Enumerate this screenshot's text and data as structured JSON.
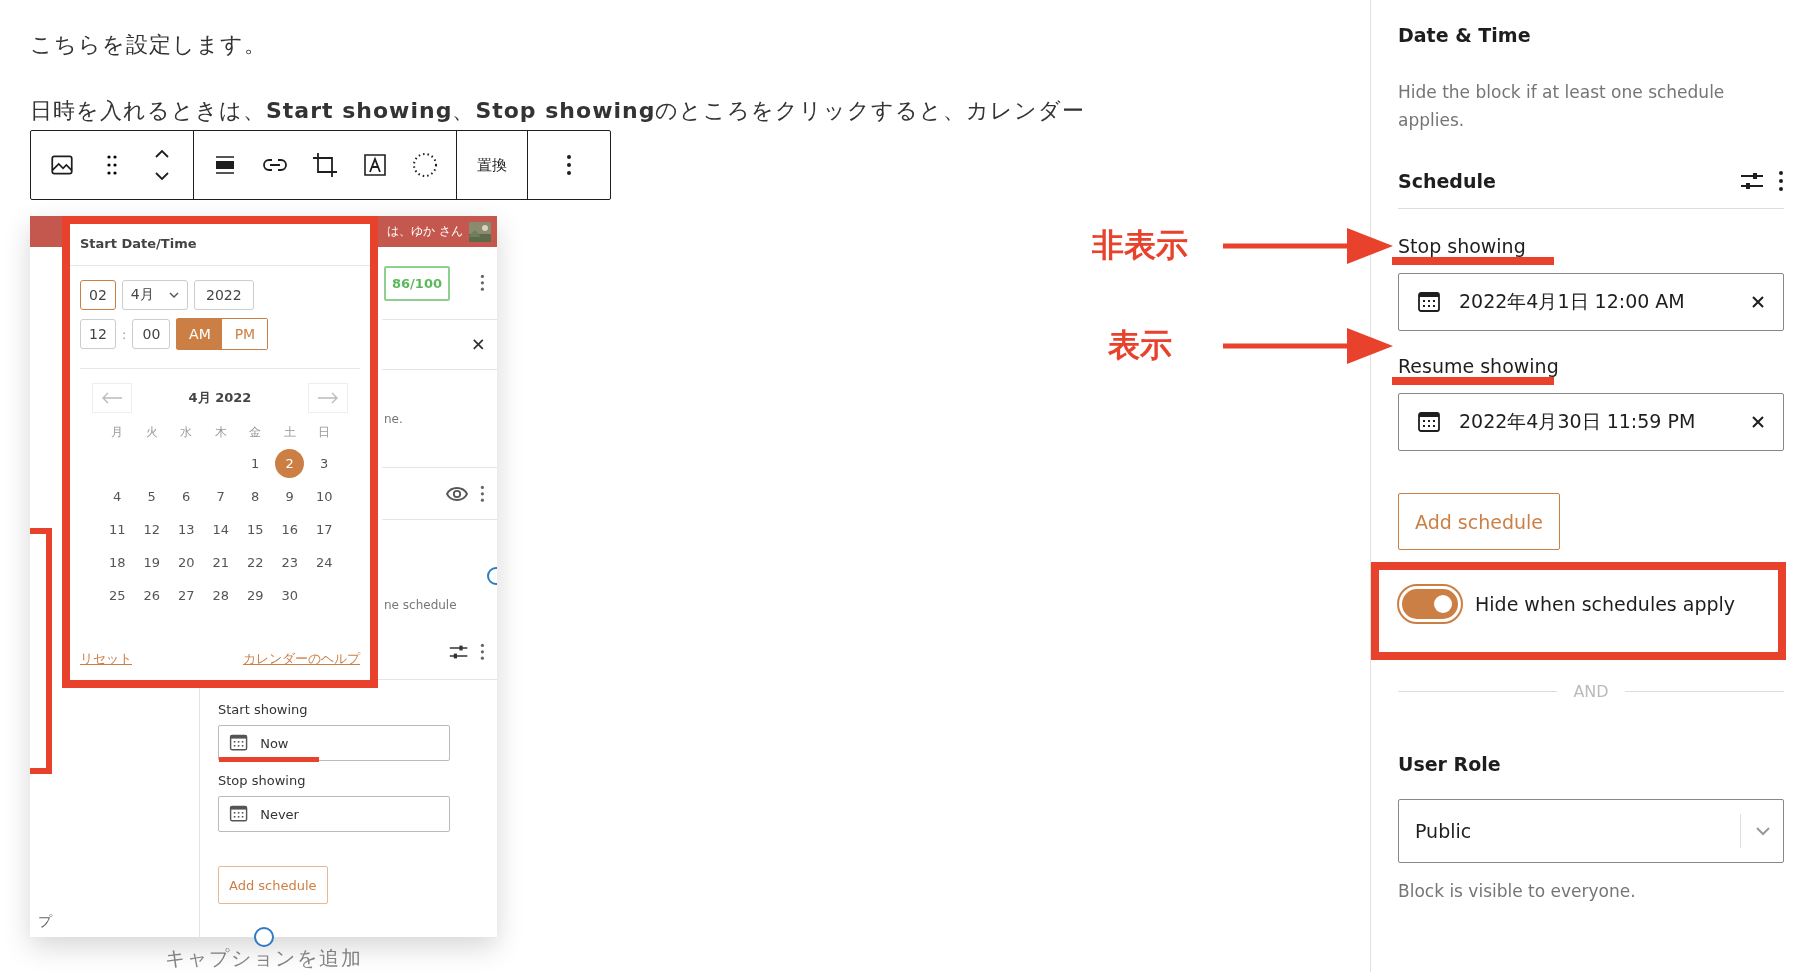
{
  "article": {
    "paragraphs": [
      "こちらを設定します。",
      "日時を入れるときは、**Start showing**、**Stop showing**のところをクリックすると、カレンダー"
    ]
  },
  "block_toolbar": {
    "replace_label": "置換"
  },
  "screenshot": {
    "header_text": "は、ゆか さん",
    "score": "86/100",
    "notice_fragment": "ne.",
    "option_fragment": "ne schedule",
    "sidebar_fragment": "プ",
    "date_picker": {
      "title": "Start Date/Time",
      "day": "02",
      "month": "4月",
      "year": "2022",
      "hour": "12",
      "separator": ":",
      "minute": "00",
      "periods": [
        {
          "label": "AM",
          "selected": true
        },
        {
          "label": "PM",
          "selected": false
        }
      ],
      "month_label": "4月 2022",
      "weekdays": [
        "月",
        "火",
        "水",
        "木",
        "金",
        "土",
        "日"
      ],
      "weeks": [
        [
          {
            "label": "1",
            "selected": false
          },
          {
            "label": "2",
            "selected": true
          },
          {
            "label": "3",
            "selected": false
          }
        ],
        [
          {
            "label": "4",
            "selected": false
          },
          {
            "label": "5",
            "selected": false
          },
          {
            "label": "6",
            "selected": false
          },
          {
            "label": "7",
            "selected": false
          },
          {
            "label": "8",
            "selected": false
          },
          {
            "label": "9",
            "selected": false
          },
          {
            "label": "10",
            "selected": false
          }
        ],
        [
          {
            "label": "11",
            "selected": false
          },
          {
            "label": "12",
            "selected": false
          },
          {
            "label": "13",
            "selected": false
          },
          {
            "label": "14",
            "selected": false
          },
          {
            "label": "15",
            "selected": false
          },
          {
            "label": "16",
            "selected": false
          },
          {
            "label": "17",
            "selected": false
          }
        ],
        [
          {
            "label": "18",
            "selected": false
          },
          {
            "label": "19",
            "selected": false
          },
          {
            "label": "20",
            "selected": false
          },
          {
            "label": "21",
            "selected": false
          },
          {
            "label": "22",
            "selected": false
          },
          {
            "label": "23",
            "selected": false
          },
          {
            "label": "24",
            "selected": false
          }
        ],
        [
          {
            "label": "25",
            "selected": false
          },
          {
            "label": "26",
            "selected": false
          },
          {
            "label": "27",
            "selected": false
          },
          {
            "label": "28",
            "selected": false
          },
          {
            "label": "29",
            "selected": false
          },
          {
            "label": "30",
            "selected": false
          }
        ]
      ],
      "links": [
        "リセット",
        "カレンダーのヘルプ"
      ]
    },
    "schedule": {
      "entries": [
        {
          "label": "Start showing",
          "value": "Now"
        },
        {
          "label": "Stop showing",
          "value": "Never"
        }
      ],
      "add_button": "Add schedule"
    }
  },
  "caption_placeholder": "キャプションを追加",
  "annotations": [
    {
      "label": "非表示"
    },
    {
      "label": "表示"
    }
  ],
  "sidebar": {
    "title": "Date & Time",
    "description": "Hide the block if at least one schedule applies.",
    "schedule_heading": "Schedule",
    "entries": [
      {
        "label": "Stop showing",
        "value": "2022年4月1日 12:00 AM"
      },
      {
        "label": "Resume showing",
        "value": "2022年4月30日 11:59 PM"
      }
    ],
    "add_button": "Add schedule",
    "toggle": {
      "label": "Hide when schedules apply",
      "on": true
    },
    "divider_label": "AND",
    "user_role": {
      "heading": "User Role",
      "value": "Public",
      "help": "Block is visible to everyone."
    }
  }
}
